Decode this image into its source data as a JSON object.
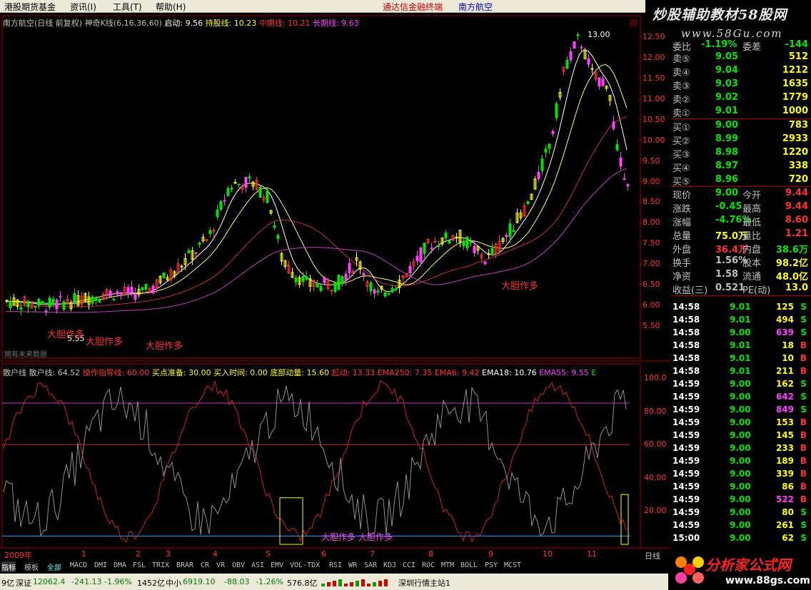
{
  "menubar": {
    "items": [
      "港股期货基金",
      "资讯(I)",
      "工具(T)",
      "帮助(H)"
    ],
    "center_title": "通达信金融终端",
    "stock_name": "南方航空"
  },
  "watermark_top": {
    "text": "炒股辅助教材58股网",
    "url": "www.58Gu.com"
  },
  "price_chart": {
    "legend": {
      "title": "南方航空(日线 前复权)",
      "indicator": "神奇K线(6,16,36,60)",
      "start_label": "启动: 9.56",
      "hold_label": "持股线: 10.23",
      "mid_label": "中期线: 10.21",
      "long_label": "长期线: 9.63"
    },
    "high_label": "13.00",
    "low_label": "5.55",
    "annotations": [
      "大胆作多",
      "大胆作多",
      "大胆作多",
      "大胆作多"
    ],
    "copyright": "拥有未来数据",
    "y_ticks": [
      "12.50",
      "12.00",
      "11.50",
      "11.00",
      "10.50",
      "10.00",
      "9.50",
      "9.00",
      "8.50",
      "8.00",
      "7.50",
      "7.00",
      "6.50",
      "6.00",
      "5.50"
    ],
    "right_marker": "田"
  },
  "osc_chart": {
    "legend": {
      "name": "散户线",
      "retail": "散户线: 64.52",
      "op_line": "操作指导线: 60.00",
      "buy_ready": "买点准备: 30.00",
      "buy_time": "买入时间: 0.00",
      "bottom": "底部动量: 15.60",
      "launch": "起动: 13.33",
      "ema250": "EMA250: 7.35",
      "ema6": "EMA6: 9.42",
      "ema18": "EMA18: 10.76",
      "ema55": "EMA55: 9.55",
      "tail": "E"
    },
    "y_ticks": [
      "100.0",
      "80.00",
      "60.00",
      "40.00",
      "20.00"
    ],
    "bottom_marks_text": "大胆作多 大胆作多"
  },
  "x_axis": {
    "labels": [
      "2009年",
      "1",
      "2",
      "3",
      "4",
      "5",
      "6",
      "7",
      "8",
      "9",
      "10",
      "11"
    ],
    "period": "日线"
  },
  "quote": {
    "top_partial": {
      "label": "委比",
      "value": "-1.19%",
      "label2": "委差",
      "value2": "-144"
    },
    "asks": [
      {
        "label": "卖⑤",
        "price": "9.05",
        "vol": "512"
      },
      {
        "label": "卖④",
        "price": "9.04",
        "vol": "1212"
      },
      {
        "label": "卖③",
        "price": "9.03",
        "vol": "1635"
      },
      {
        "label": "卖②",
        "price": "9.02",
        "vol": "1779"
      },
      {
        "label": "卖①",
        "price": "9.01",
        "vol": "1000"
      }
    ],
    "bids": [
      {
        "label": "买①",
        "price": "9.00",
        "vol": "783"
      },
      {
        "label": "买②",
        "price": "8.99",
        "vol": "2933"
      },
      {
        "label": "买③",
        "price": "8.98",
        "vol": "1220"
      },
      {
        "label": "买④",
        "price": "8.97",
        "vol": "338"
      },
      {
        "label": "买⑤",
        "price": "8.96",
        "vol": "720"
      }
    ],
    "stats": [
      {
        "l1": "现价",
        "v1": "9.00",
        "l2": "今开",
        "v2": "9.44"
      },
      {
        "l1": "涨跌",
        "v1": "-0.45",
        "l2": "最高",
        "v2": "9.44"
      },
      {
        "l1": "涨幅",
        "v1": "-4.76%",
        "l2": "最低",
        "v2": "8.60"
      },
      {
        "l1": "总量",
        "v1": "75.0万",
        "l2": "量比",
        "v2": "1.21"
      },
      {
        "l1": "外盘",
        "v1": "36.4万",
        "l2": "内盘",
        "v2": "38.6万"
      },
      {
        "l1": "换手",
        "v1": "1.56%",
        "l2": "股本",
        "v2": "98.2亿"
      },
      {
        "l1": "净资",
        "v1": "1.58",
        "l2": "流通",
        "v2": "48.0亿"
      },
      {
        "l1": "收益(三)",
        "v1": "0.521",
        "l2": "PE(动)",
        "v2": "13.0"
      }
    ]
  },
  "ticks": [
    {
      "time": "14:58",
      "price": "9.01",
      "vol": "125",
      "side": "S"
    },
    {
      "time": "14:58",
      "price": "9.01",
      "vol": "494",
      "side": "S"
    },
    {
      "time": "14:58",
      "price": "9.00",
      "vol": "639",
      "side": "S"
    },
    {
      "time": "14:58",
      "price": "9.01",
      "vol": "18",
      "side": "B"
    },
    {
      "time": "14:58",
      "price": "9.01",
      "vol": "10",
      "side": "B"
    },
    {
      "time": "14:58",
      "price": "9.01",
      "vol": "211",
      "side": "B"
    },
    {
      "time": "14:59",
      "price": "9.00",
      "vol": "162",
      "side": "S"
    },
    {
      "time": "14:59",
      "price": "9.00",
      "vol": "642",
      "side": "S"
    },
    {
      "time": "14:59",
      "price": "9.00",
      "vol": "849",
      "side": "S"
    },
    {
      "time": "14:59",
      "price": "9.00",
      "vol": "153",
      "side": "B"
    },
    {
      "time": "14:59",
      "price": "9.00",
      "vol": "145",
      "side": "B"
    },
    {
      "time": "14:59",
      "price": "9.00",
      "vol": "233",
      "side": "B"
    },
    {
      "time": "14:59",
      "price": "9.00",
      "vol": "189",
      "side": "B"
    },
    {
      "time": "14:59",
      "price": "9.00",
      "vol": "339",
      "side": "B"
    },
    {
      "time": "14:59",
      "price": "9.00",
      "vol": "86",
      "side": "B"
    },
    {
      "time": "14:59",
      "price": "9.00",
      "vol": "522",
      "side": "B"
    },
    {
      "time": "14:59",
      "price": "9.00",
      "vol": "80",
      "side": "S"
    },
    {
      "time": "14:59",
      "price": "9.00",
      "vol": "261",
      "side": "S"
    },
    {
      "time": "15:00",
      "price": "9.00",
      "vol": "62",
      "side": "S"
    }
  ],
  "tabs": [
    "指标",
    "模板",
    "全部",
    "MACD",
    "DMI",
    "DMA",
    "FSL",
    "TRIX",
    "BRAR",
    "CR",
    "VR",
    "OBV",
    "ASI",
    "EMV",
    "VOL-TDX",
    "RSI",
    "WR",
    "SAR",
    "KDJ",
    "CCI",
    "ROC",
    "MTM",
    "BOLL",
    "PSY",
    "MCST"
  ],
  "status": {
    "a": "9亿",
    "sz_label": "深证",
    "sz_value": "12062.4",
    "sz_change": "-241.13",
    "sz_pct": "-1.96%",
    "sz_amount": "1452亿",
    "zx_label": "中小",
    "zx_value": "6919.10",
    "zx_change": "-88.03",
    "zx_pct": "-1.26%",
    "zx_amount": "576.8亿",
    "server": "深圳行情主站1"
  },
  "watermark_bottom": {
    "text": "分析家公式网",
    "url": "www.88gs.com"
  },
  "colors": {
    "up": "#ff3232",
    "down": "#54ffff",
    "flat": "#ffffff",
    "green": "#00e600",
    "yellow": "#ffff00",
    "magenta": "#ff40ff",
    "grid_red": "#a00000"
  }
}
